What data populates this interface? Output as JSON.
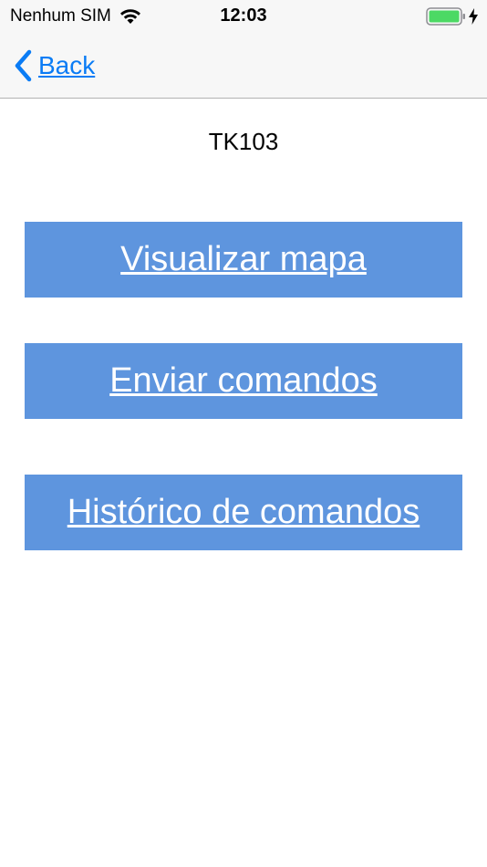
{
  "status_bar": {
    "carrier": "Nenhum SIM",
    "time": "12:03",
    "wifi_icon": "wifi-icon",
    "battery_icon": "battery-icon",
    "charging_icon": "bolt-icon",
    "battery_color": "#4cd964"
  },
  "nav_bar": {
    "back_label": "Back",
    "back_icon": "chevron-left-icon",
    "tint_color": "#0a7cf5"
  },
  "main": {
    "device_name": "TK103",
    "buttons": [
      {
        "label": "Visualizar mapa"
      },
      {
        "label": "Enviar comandos"
      },
      {
        "label": "Histórico de comandos"
      }
    ],
    "button_color": "#5e95de"
  }
}
